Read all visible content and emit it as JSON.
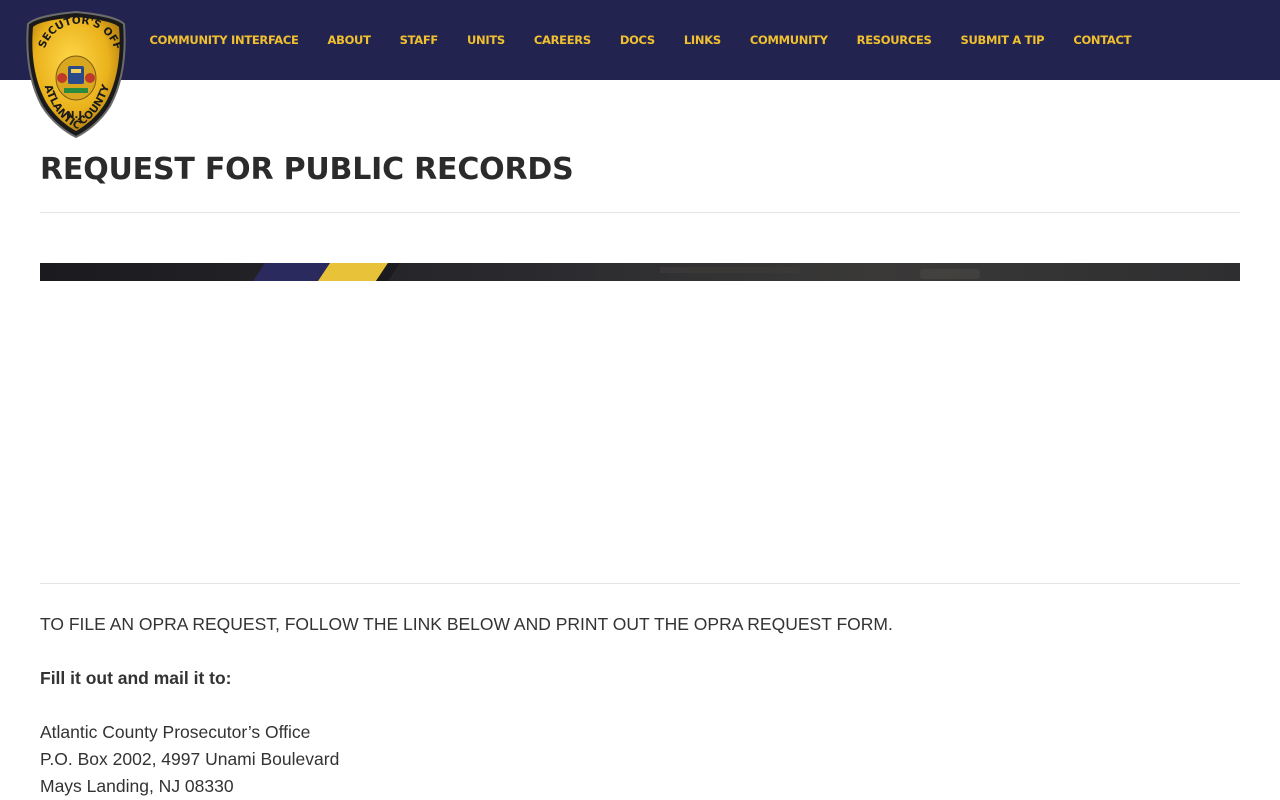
{
  "header": {
    "logo": {
      "top_text": "PROSECUTOR'S OFFICE",
      "bottom_text": "ATLANTIC COUNTY",
      "state_text": "N.J."
    },
    "nav": [
      {
        "label": "COMMUNITY INTERFACE"
      },
      {
        "label": "ABOUT"
      },
      {
        "label": "STAFF"
      },
      {
        "label": "UNITS"
      },
      {
        "label": "CAREERS"
      },
      {
        "label": "DOCS"
      },
      {
        "label": "LINKS"
      },
      {
        "label": "COMMUNITY"
      },
      {
        "label": "RESOURCES"
      },
      {
        "label": "SUBMIT A TIP"
      },
      {
        "label": "CONTACT"
      }
    ]
  },
  "page": {
    "title": "REQUEST FOR PUBLIC RECORDS"
  },
  "content": {
    "intro": "TO FILE AN OPRA REQUEST, FOLLOW THE LINK BELOW AND PRINT OUT THE OPRA REQUEST FORM.",
    "mail_label": "Fill it out and mail it to:",
    "address": {
      "line1": "Atlantic County Prosecutor’s Office",
      "line2": "P.O. Box 2002, 4997 Unami Boulevard",
      "line3": "Mays Landing, NJ 08330"
    }
  },
  "colors": {
    "header_bg": "#23234f",
    "nav_text": "#f0c030",
    "accent_gold": "#e8c33a"
  }
}
